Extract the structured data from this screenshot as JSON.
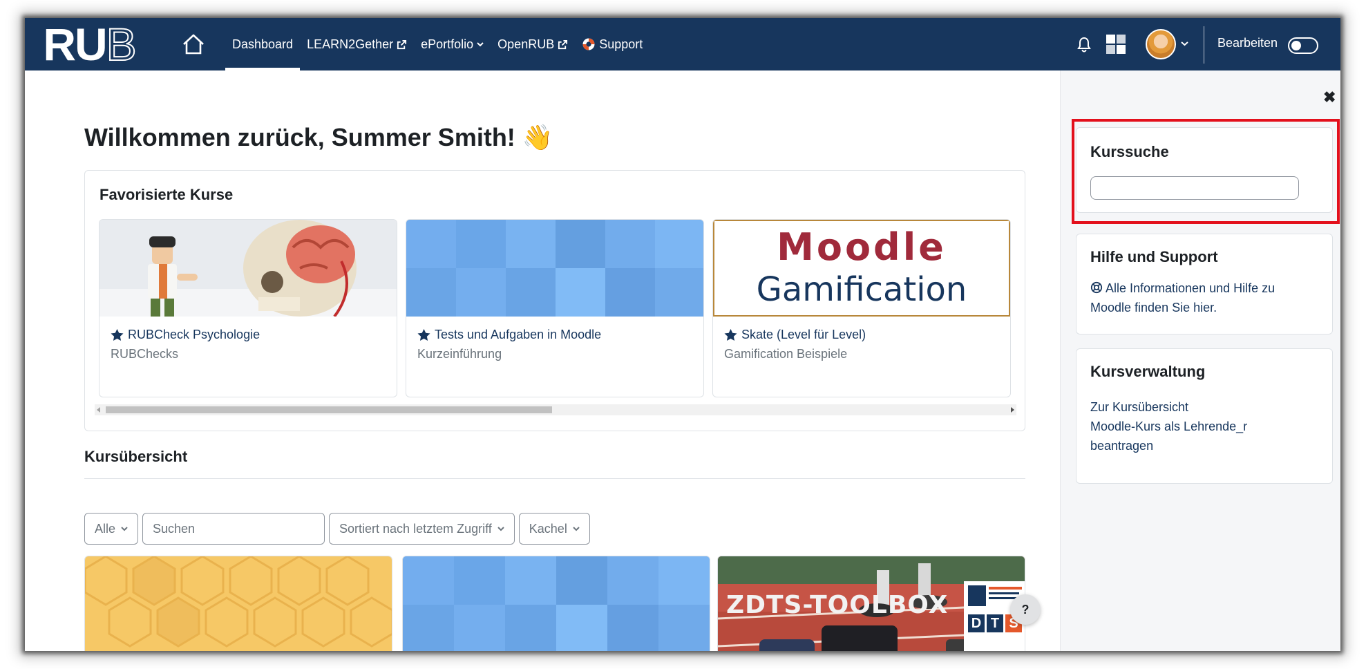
{
  "navbar": {
    "logo": "RUB",
    "links": [
      {
        "label": "Dashboard",
        "active": true
      },
      {
        "label": "LEARN2Gether",
        "external": true
      },
      {
        "label": "ePortfolio",
        "dropdown": true
      },
      {
        "label": "OpenRUB",
        "external": true
      },
      {
        "label": "Support",
        "icon": "lifebuoy-icon"
      }
    ],
    "edit_label": "Bearbeiten",
    "edit_mode_on": false,
    "icons": [
      "home-icon",
      "bell-icon",
      "block-drawer-icon",
      "avatar",
      "chevron-down-icon"
    ],
    "colors": {
      "navbar_bg": "#17365d",
      "link_color": "#17365d",
      "highlight_border": "#e3101c"
    }
  },
  "main": {
    "welcome": "Willkommen zurück, Summer Smith! 👋",
    "favourites": {
      "title": "Favorisierte Kurse",
      "courses": [
        {
          "name": "RUBCheck Psychologie",
          "category": "RUBChecks",
          "starred": true
        },
        {
          "name": "Tests und Aufgaben in Moodle",
          "category": "Kurzeinführung",
          "starred": true
        },
        {
          "name": "Skate (Level für Level)",
          "category": "Gamification Beispiele",
          "starred": true,
          "image_text": [
            "Moodle",
            "Gamification"
          ]
        }
      ]
    },
    "overview": {
      "title": "Kursübersicht",
      "filters": {
        "group": "Alle",
        "search_placeholder": "Suchen",
        "sort": "Sortiert nach letztem Zugriff",
        "view": "Kachel"
      },
      "cards": [
        {
          "image": "honeycomb"
        },
        {
          "image": "blue-tiles"
        },
        {
          "image": "photo",
          "image_text": "ZDTS-TOOLBOX",
          "badge": [
            "D",
            "T",
            "S"
          ]
        }
      ]
    },
    "help_button": "?"
  },
  "drawer": {
    "close": "✖",
    "search_block": {
      "title": "Kurssuche",
      "value": ""
    },
    "support_block": {
      "title": "Hilfe und Support",
      "link_line1": "Alle Informationen und Hilfe zu",
      "link_line2": "Moodle finden Sie hier."
    },
    "admin_block": {
      "title": "Kursverwaltung",
      "link1": "Zur Kursübersicht",
      "link2_line1": "Moodle-Kurs als Lehrende_r",
      "link2_line2": "beantragen"
    }
  }
}
